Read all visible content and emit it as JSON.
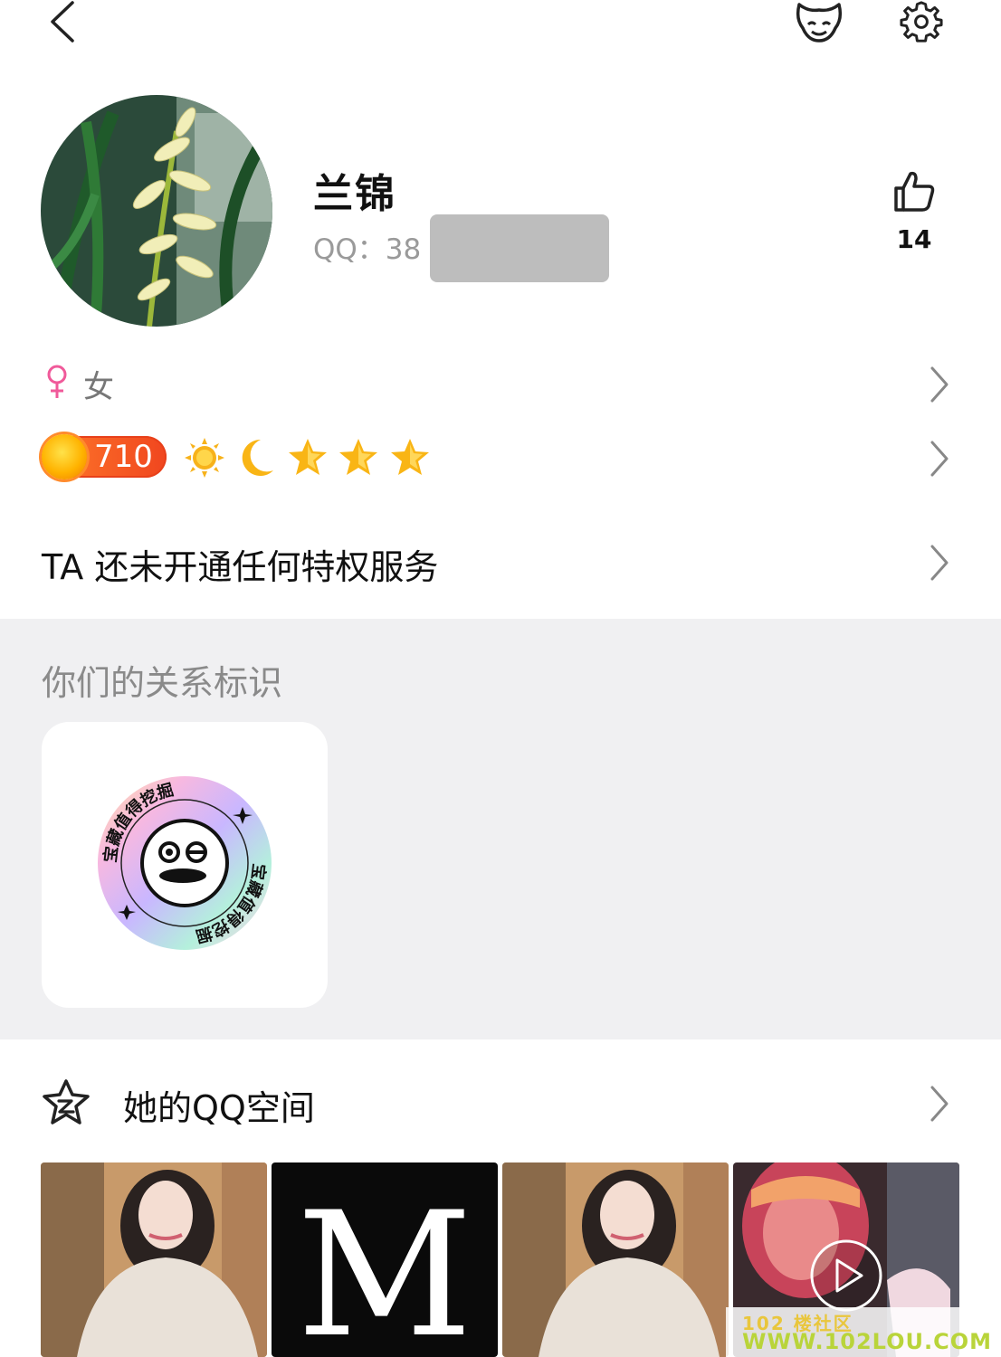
{
  "profile": {
    "nickname": "兰锦",
    "qq_label": "QQ：38",
    "likes": "14",
    "gender": "女"
  },
  "level": {
    "coin_value": "710",
    "icons": [
      "sun-icon",
      "moon-icon",
      "star-icon",
      "star-icon",
      "star-icon"
    ]
  },
  "privilege": {
    "text": "TA 还未开通任何特权服务"
  },
  "relationship": {
    "title": "你们的关系标识",
    "badge_text": "宝藏值得挖掘"
  },
  "qzone": {
    "title": "她的QQ空间",
    "photos": [
      "photo-1",
      "photo-2-m-logo",
      "photo-3",
      "video-4"
    ],
    "m_letter": "M"
  },
  "watermark": {
    "line1": "102 楼社区",
    "line2": "WWW.102LOU.COM"
  },
  "colors": {
    "accent_orange": "#f0461f",
    "female_pink": "#f05a9a",
    "gray_bg": "#f0f0f2"
  }
}
